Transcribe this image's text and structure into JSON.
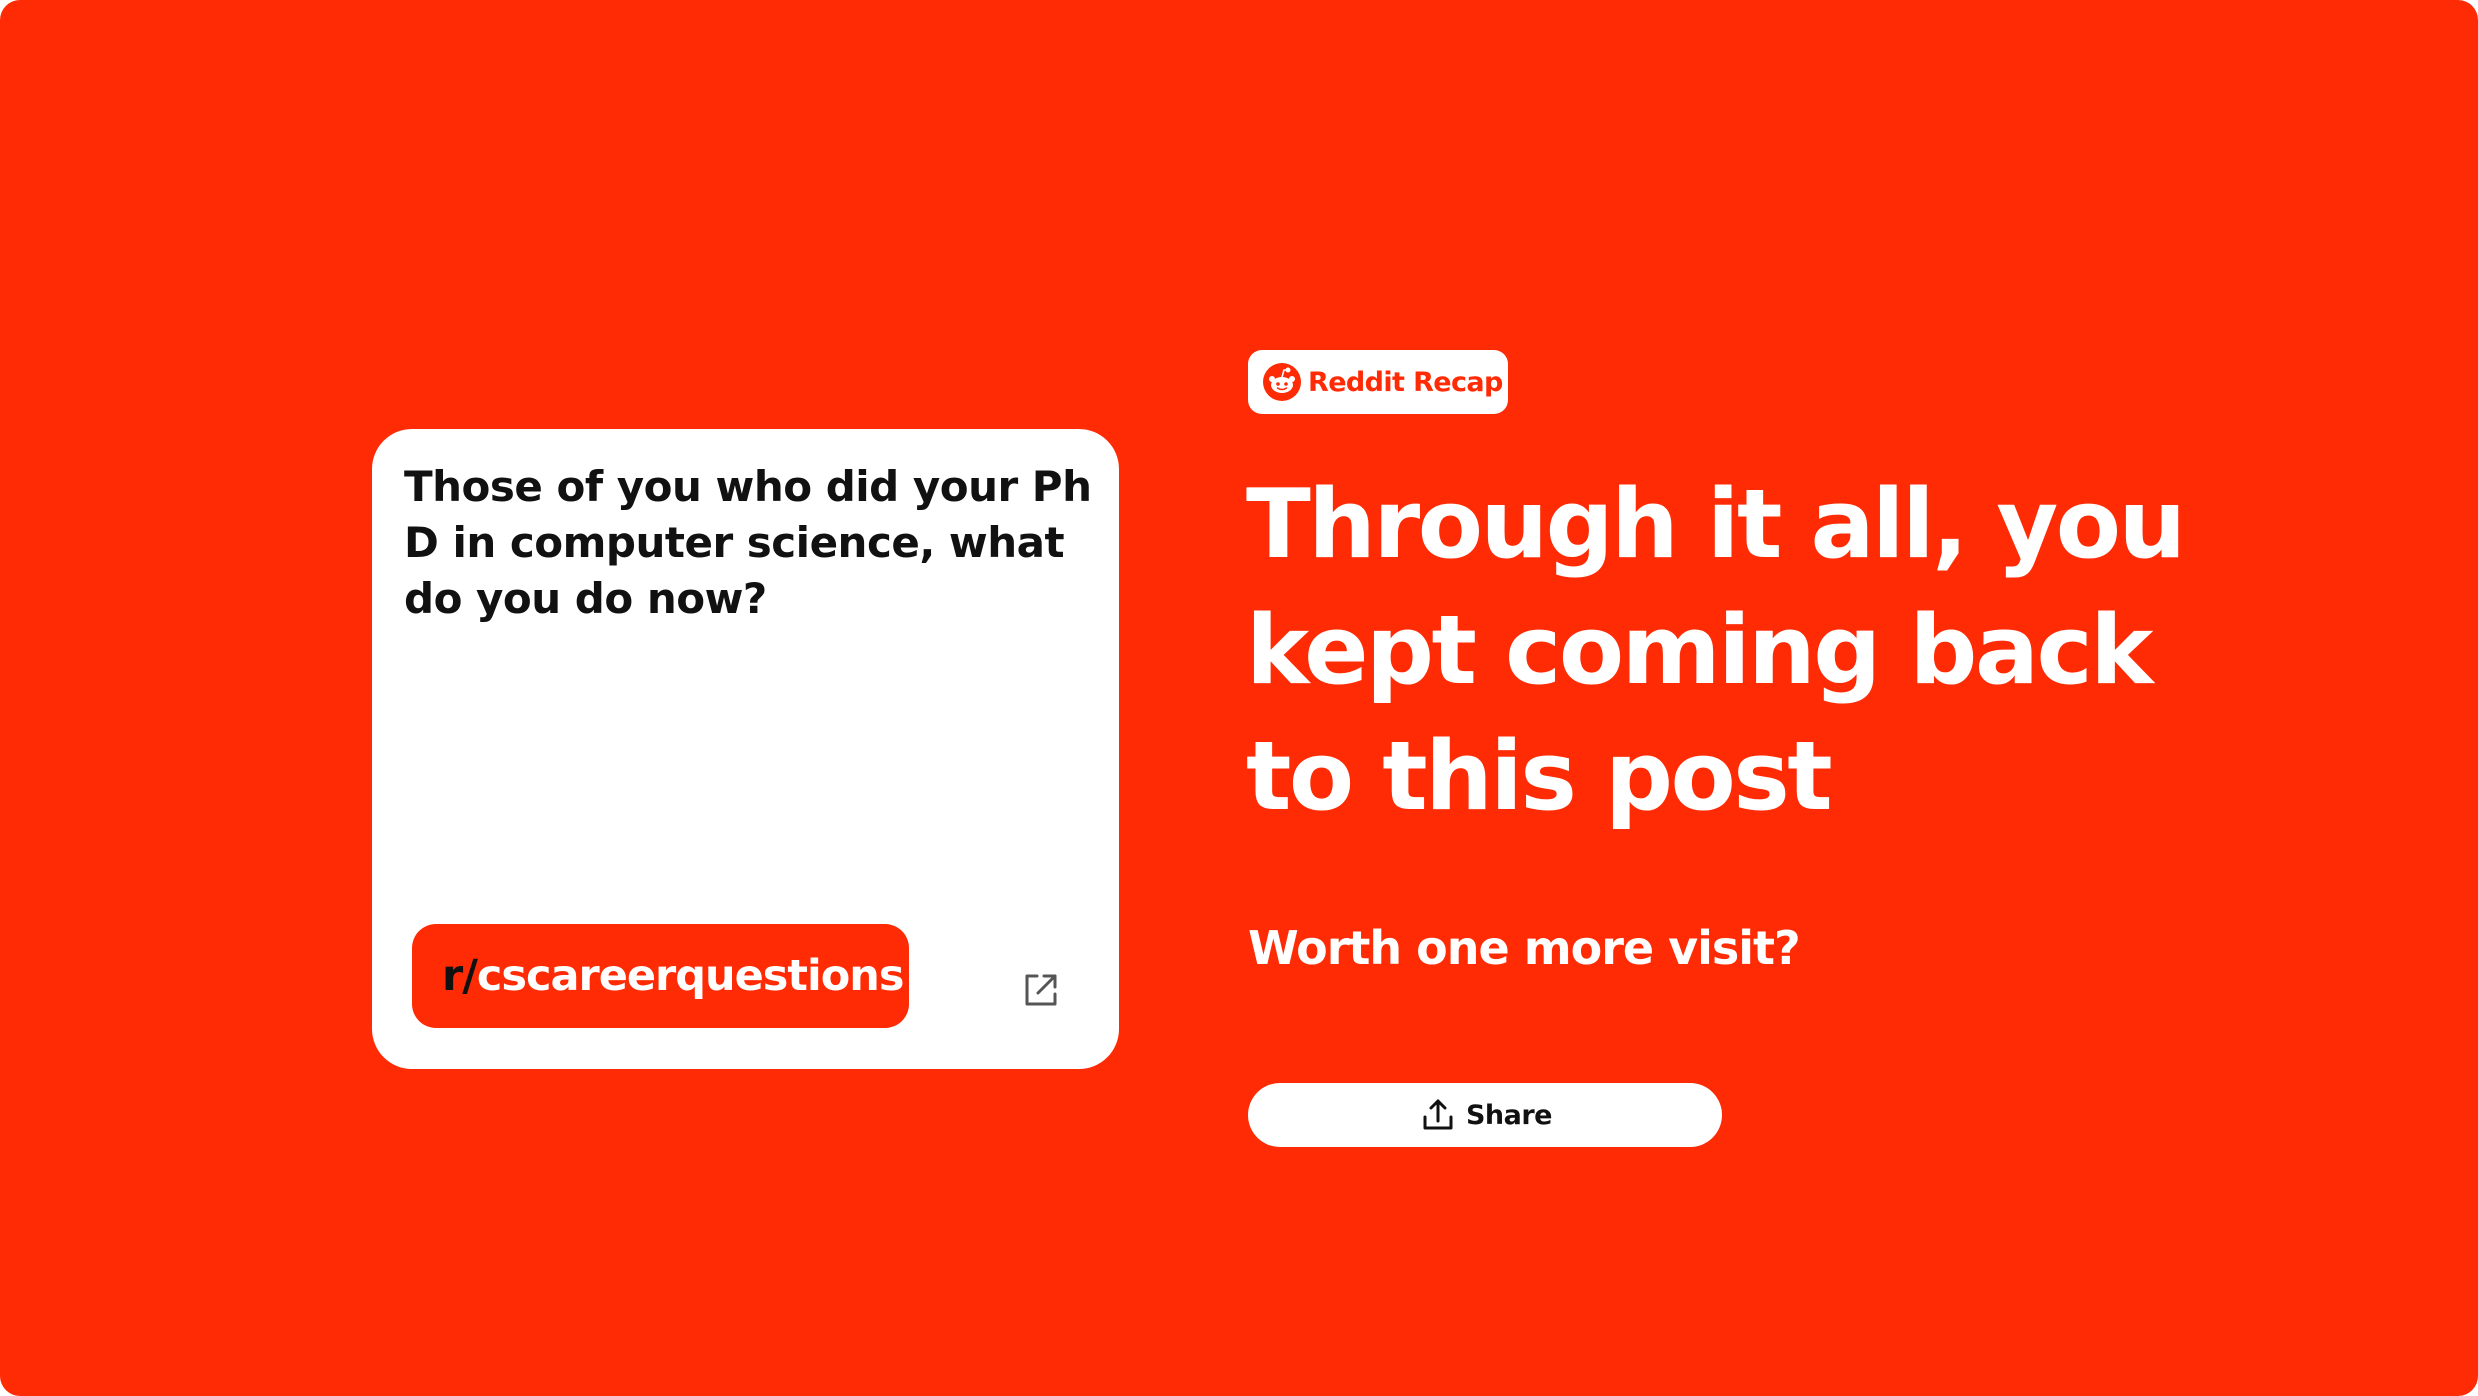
{
  "colors": {
    "background": "#ff2b05",
    "card": "#ffffff",
    "text_dark": "#111111",
    "text_light": "#ffffff",
    "accent": "#ff2b05"
  },
  "badge": {
    "icon": "reddit-snoo-icon",
    "label": "Reddit Recap"
  },
  "post": {
    "title": "Those of you who did your PhD in computer science, what do you do now?",
    "subreddit_prefix": "r/",
    "subreddit_name": "cscareerquestions",
    "open_icon": "external-link-icon"
  },
  "headline": "Through it all, you kept coming back to this post",
  "subline": "Worth one more visit?",
  "share": {
    "icon": "share-upload-icon",
    "label": "Share"
  }
}
